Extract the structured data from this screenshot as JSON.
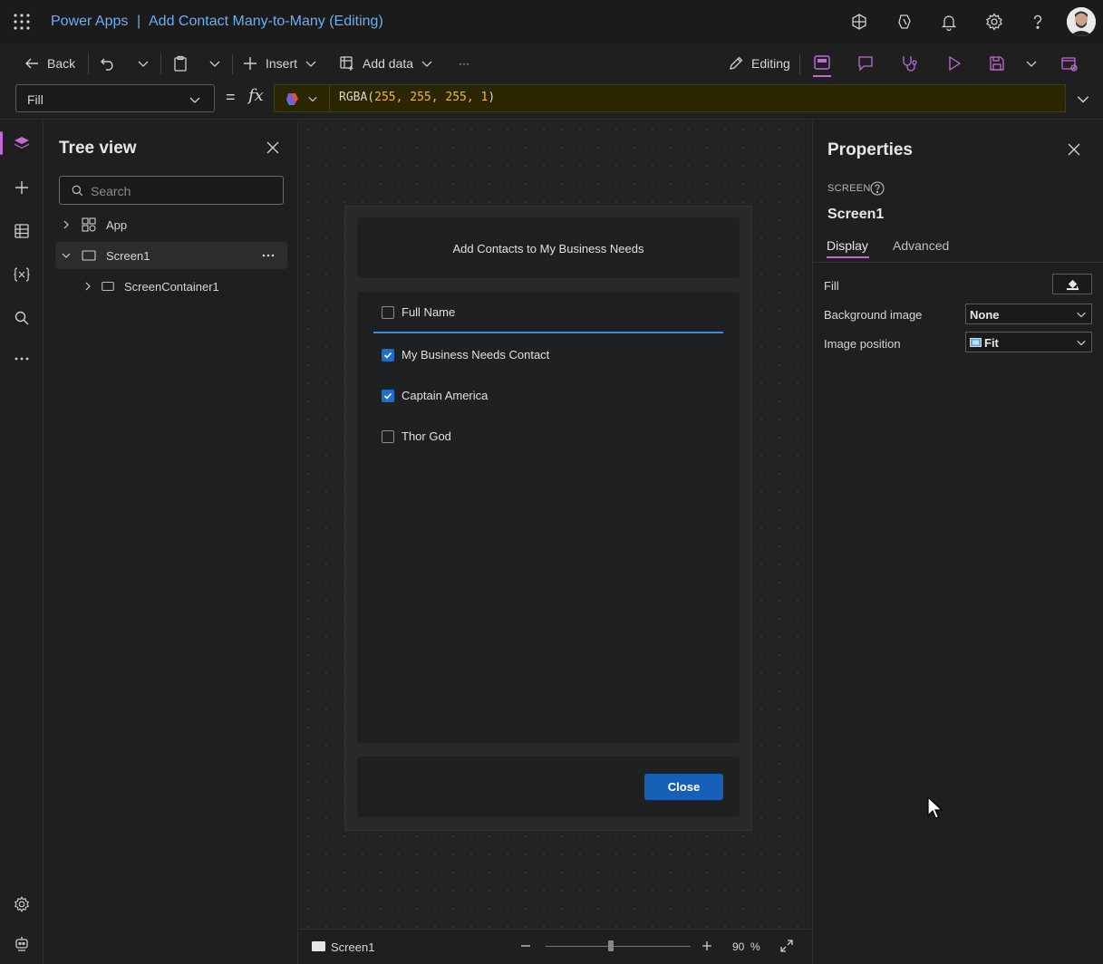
{
  "titlebar": {
    "app_name": "Power Apps",
    "separator": "|",
    "title": "Add Contact Many-to-Many (Editing)"
  },
  "commandbar": {
    "back_label": "Back",
    "insert_label": "Insert",
    "add_data_label": "Add data",
    "more_label": "···",
    "editing_label": "Editing"
  },
  "formulabar": {
    "property": "Fill",
    "equals": "=",
    "fx": "fx",
    "formula_fn": "RGBA(",
    "formula_args": "255, 255, 255, 1",
    "formula_close": ")"
  },
  "treeview": {
    "title": "Tree view",
    "search_placeholder": "Search",
    "items": [
      {
        "label": "App"
      },
      {
        "label": "Screen1"
      },
      {
        "label": "ScreenContainer1"
      }
    ]
  },
  "canvas": {
    "header": "Add Contacts to My Business Needs",
    "list_header": "Full Name",
    "contacts": [
      {
        "name": "My Business Needs Contact",
        "checked": true
      },
      {
        "name": "Captain America",
        "checked": true
      },
      {
        "name": "Thor God",
        "checked": false
      }
    ],
    "close_button": "Close"
  },
  "statusbar": {
    "screen_name": "Screen1",
    "zoom": "90",
    "zoom_unit": "%",
    "zoom_level": 0.45
  },
  "properties": {
    "title": "Properties",
    "kind": "SCREEN",
    "name": "Screen1",
    "tabs": [
      "Display",
      "Advanced"
    ],
    "active_tab": "Display",
    "fill_label": "Fill",
    "background_image_label": "Background image",
    "background_image_value": "None",
    "image_position_label": "Image position",
    "image_position_value": "Fit"
  },
  "colors": {
    "accent": "#c06bd8",
    "title_link": "#6aaef5",
    "primary_button": "#1660b8",
    "formula_bg": "#2a2600"
  }
}
